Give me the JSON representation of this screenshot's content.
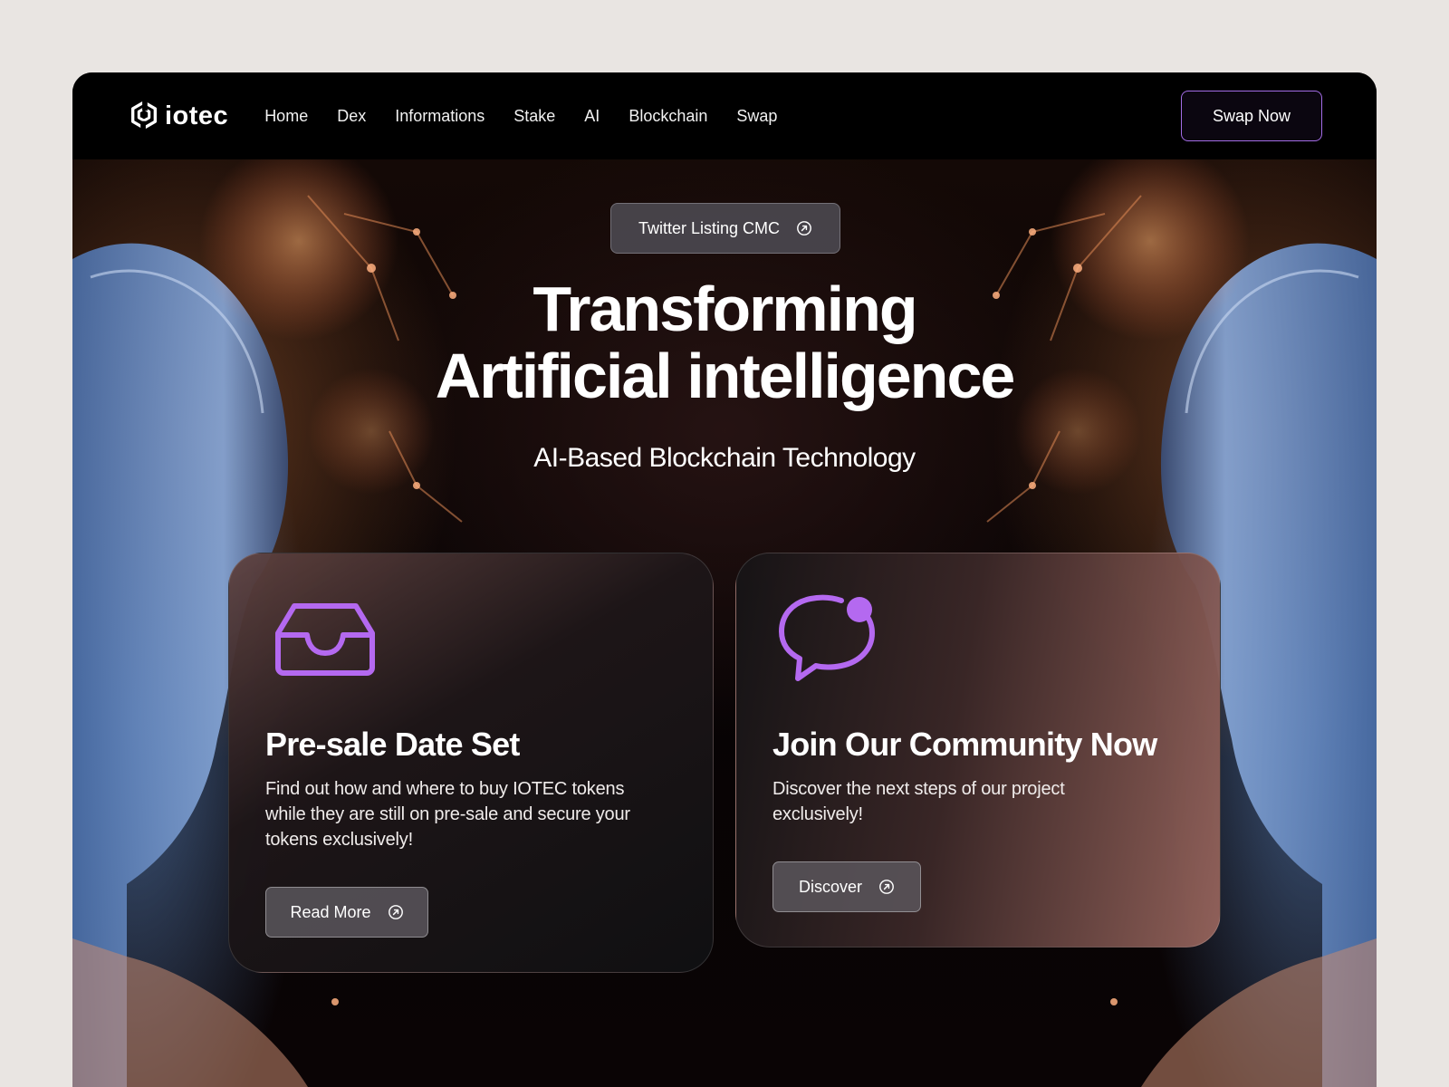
{
  "brand": {
    "name": "iotec"
  },
  "nav": {
    "items": [
      {
        "label": "Home"
      },
      {
        "label": "Dex"
      },
      {
        "label": "Informations"
      },
      {
        "label": "Stake"
      },
      {
        "label": "AI"
      },
      {
        "label": "Blockchain"
      },
      {
        "label": "Swap"
      }
    ],
    "cta_label": "Swap Now"
  },
  "hero": {
    "pill_label": "Twitter Listing CMC",
    "title_line1": "Transforming",
    "title_line2": "Artificial intelligence",
    "subtitle": "AI-Based Blockchain Technology"
  },
  "cards": [
    {
      "icon": "inbox-icon",
      "title": "Pre-sale Date Set",
      "description": "Find out how and where to buy IOTEC tokens while they are still on pre-sale and secure your tokens exclusively!",
      "button_label": "Read More"
    },
    {
      "icon": "chat-notification-icon",
      "title": "Join Our Community Now",
      "description": "Discover the next steps of our project exclusively!",
      "button_label": "Discover"
    }
  ],
  "colors": {
    "page_background": "#e9e5e2",
    "frame_background": "#000000",
    "accent_purple": "#b469f0",
    "cta_border": "#a36de6",
    "text_primary": "#ffffff"
  }
}
